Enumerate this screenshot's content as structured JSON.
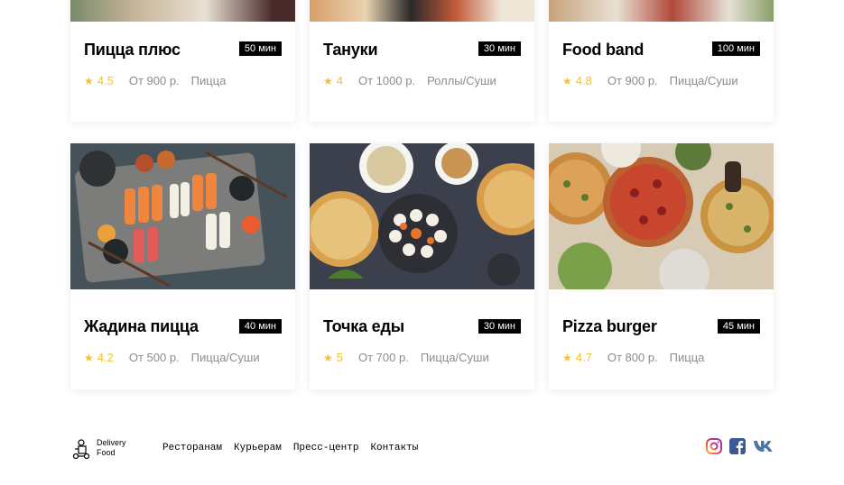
{
  "cards": [
    {
      "name": "Пицца плюс",
      "time": "50 мин",
      "rating": "4.5",
      "price": "От 900 р.",
      "kind": "Пицца"
    },
    {
      "name": "Тануки",
      "time": "30 мин",
      "rating": "4",
      "price": "От 1000 р.",
      "kind": "Роллы/Суши"
    },
    {
      "name": "Food band",
      "time": "100 мин",
      "rating": "4.8",
      "price": "От 900 р.",
      "kind": "Пицца/Суши"
    },
    {
      "name": "Жадина пицца",
      "time": "40 мин",
      "rating": "4.2",
      "price": "От 500 р.",
      "kind": "Пицца/Суши"
    },
    {
      "name": "Точка еды",
      "time": "30 мин",
      "rating": "5",
      "price": "От 700 р.",
      "kind": "Пицца/Суши"
    },
    {
      "name": "Pizza burger",
      "time": "45 мин",
      "rating": "4.7",
      "price": "От 800 р.",
      "kind": "Пицца"
    }
  ],
  "footer": {
    "logo_line1": "Delivery",
    "logo_line2": "Food",
    "nav": [
      "Ресторанам",
      "Курьерам",
      "Пресс-центр",
      "Контакты"
    ],
    "social_icons": [
      "instagram-icon",
      "facebook-icon",
      "vk-icon"
    ]
  },
  "colors": {
    "accent": "#f4c034",
    "badge": "#000000",
    "muted": "#8c8c8c"
  }
}
